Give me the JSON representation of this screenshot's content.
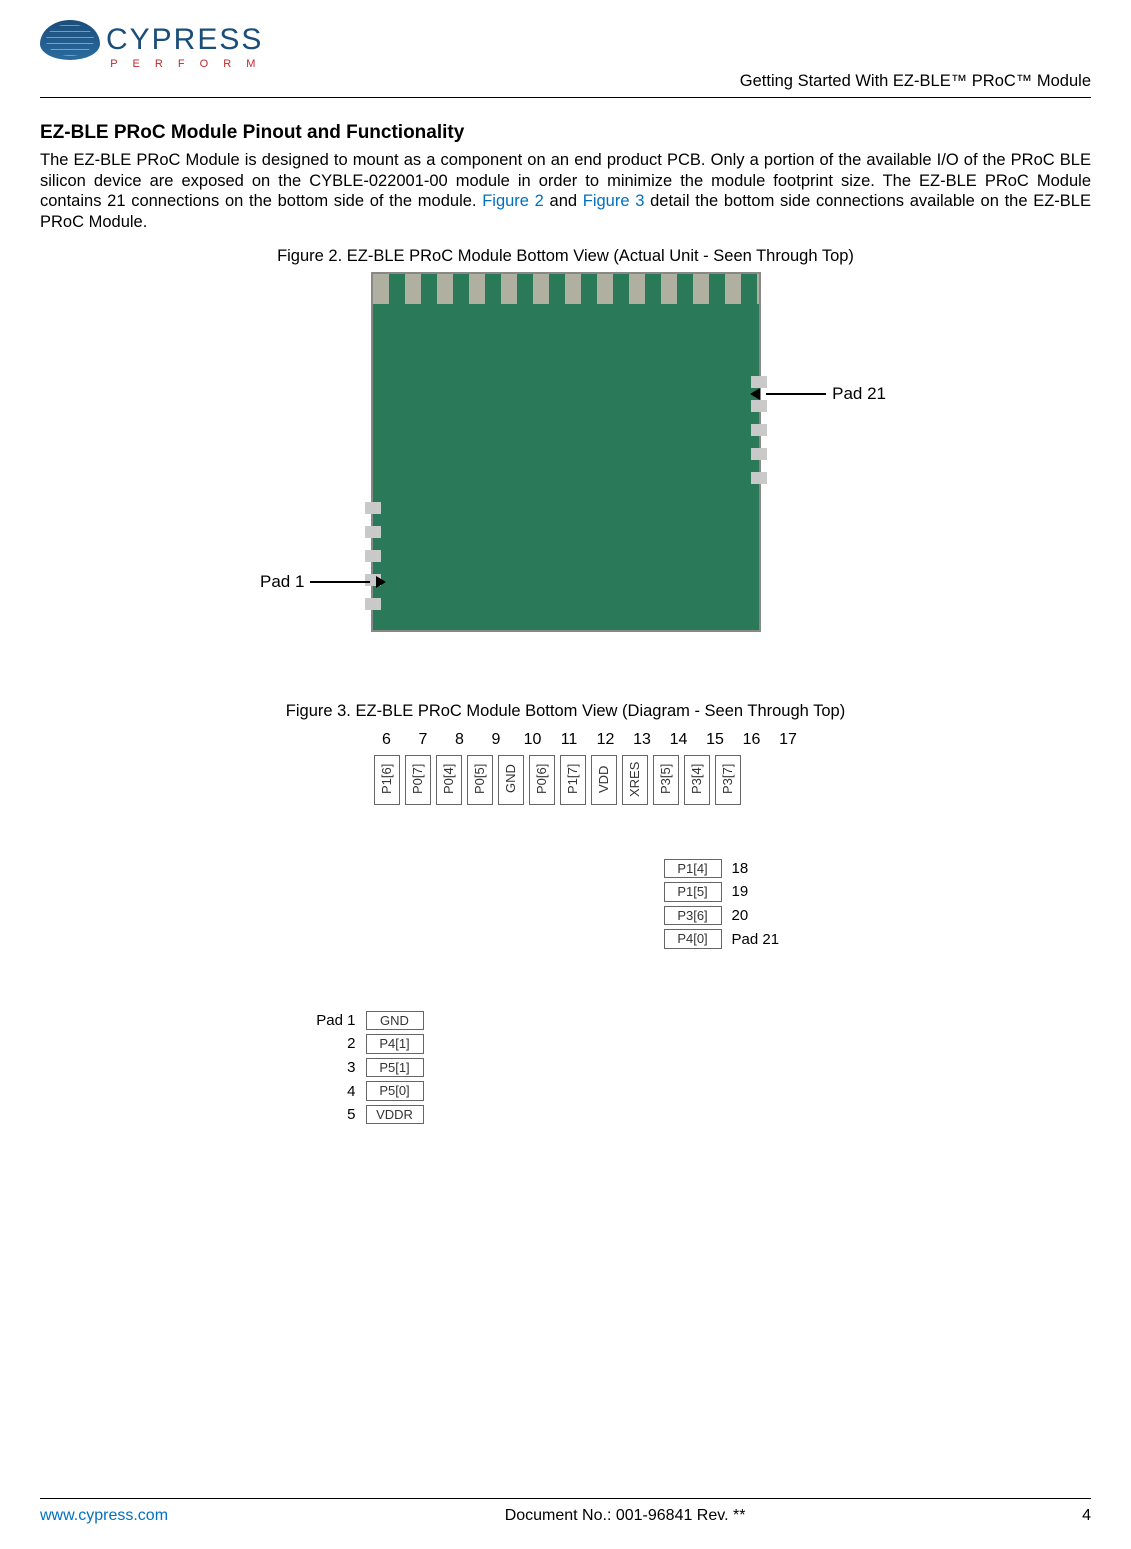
{
  "header": {
    "logo_main": "CYPRESS",
    "logo_sub": "P E R F O R M",
    "doc_title": "Getting Started With EZ-BLE™ PRoC™ Module"
  },
  "section": {
    "heading": "EZ-BLE PRoC Module Pinout and Functionality",
    "para_a": "The EZ-BLE PRoC Module is designed to mount as a component on an end product PCB. Only a portion of the available I/O of the PRoC BLE silicon device are exposed on the CYBLE-022001-00 module in order to minimize the module footprint size. The EZ-BLE PRoC Module contains 21 connections on the bottom side of the module. ",
    "link1": "Figure 2",
    "mid": " and ",
    "link2": "Figure 3",
    "para_b": " detail the bottom side connections available on the EZ-BLE PRoC Module."
  },
  "fig2": {
    "caption": "Figure 2. EZ-BLE PRoC Module Bottom View (Actual Unit - Seen Through Top)",
    "pad1": "Pad 1",
    "pad21": "Pad 21"
  },
  "fig3": {
    "caption": "Figure 3. EZ-BLE PRoC Module Bottom View (Diagram - Seen Through Top)",
    "top_nums": [
      "6",
      "7",
      "8",
      "9",
      "10",
      "11",
      "12",
      "13",
      "14",
      "15",
      "16",
      "17"
    ],
    "top_pins": [
      "P1[6]",
      "P0[7]",
      "P0[4]",
      "P0[5]",
      "GND",
      "P0[6]",
      "P1[7]",
      "VDD",
      "XRES",
      "P3[5]",
      "P3[4]",
      "P3[7]"
    ],
    "right": [
      {
        "pin": "P1[4]",
        "num": "18"
      },
      {
        "pin": "P1[5]",
        "num": "19"
      },
      {
        "pin": "P3[6]",
        "num": "20"
      },
      {
        "pin": "P4[0]",
        "num": "Pad 21"
      }
    ],
    "left": [
      {
        "num": "5",
        "pin": "VDDR"
      },
      {
        "num": "4",
        "pin": "P5[0]"
      },
      {
        "num": "3",
        "pin": "P5[1]"
      },
      {
        "num": "2",
        "pin": "P4[1]"
      },
      {
        "num": "Pad 1",
        "pin": "GND"
      }
    ]
  },
  "footer": {
    "url": "www.cypress.com",
    "docno": "Document No.: 001-96841 Rev. **",
    "page": "4"
  }
}
